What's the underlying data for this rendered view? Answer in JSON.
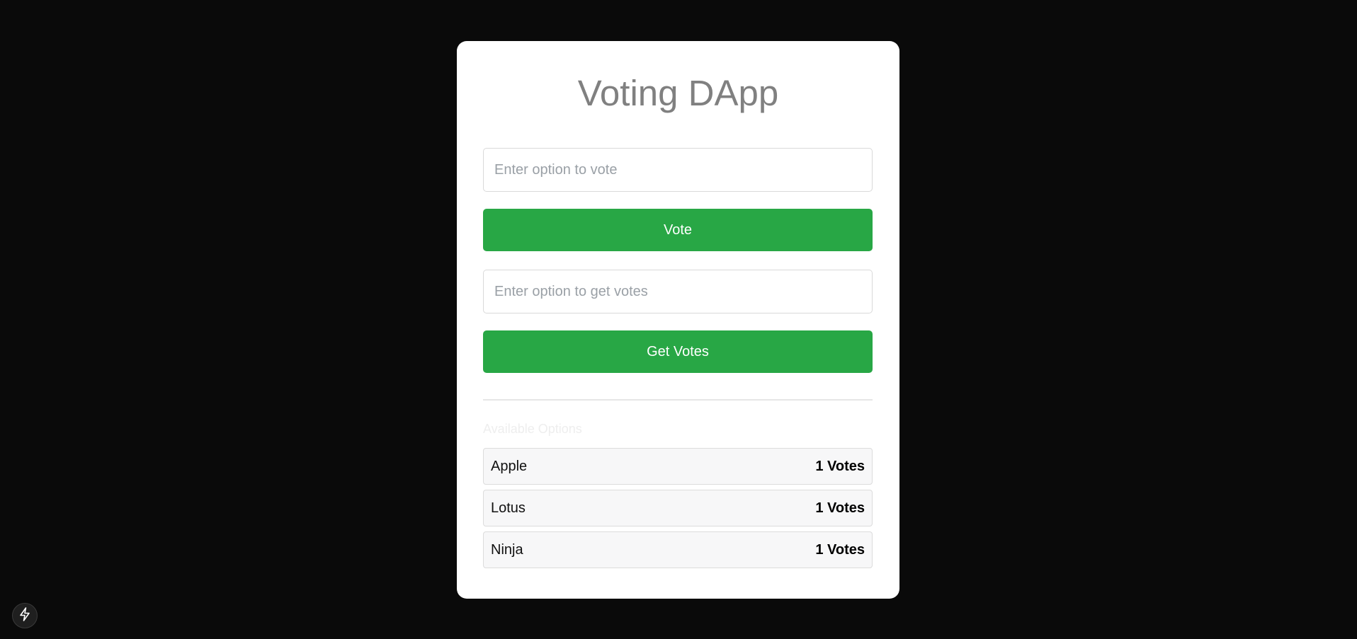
{
  "app": {
    "title": "Voting DApp"
  },
  "vote_form": {
    "input_placeholder": "Enter option to vote",
    "input_value": "",
    "button_label": "Vote"
  },
  "get_votes_form": {
    "input_placeholder": "Enter option to get votes",
    "input_value": "",
    "button_label": "Get Votes"
  },
  "options_section": {
    "title": "Available Options",
    "items": [
      {
        "name": "Apple",
        "votes": "1 Votes"
      },
      {
        "name": "Lotus",
        "votes": "1 Votes"
      },
      {
        "name": "Ninja",
        "votes": "1 Votes"
      }
    ]
  },
  "colors": {
    "background": "#0a0a0a",
    "card": "#ffffff",
    "button": "#28a745",
    "title": "#808080"
  },
  "icons": {
    "corner_badge": "lightning-icon"
  }
}
